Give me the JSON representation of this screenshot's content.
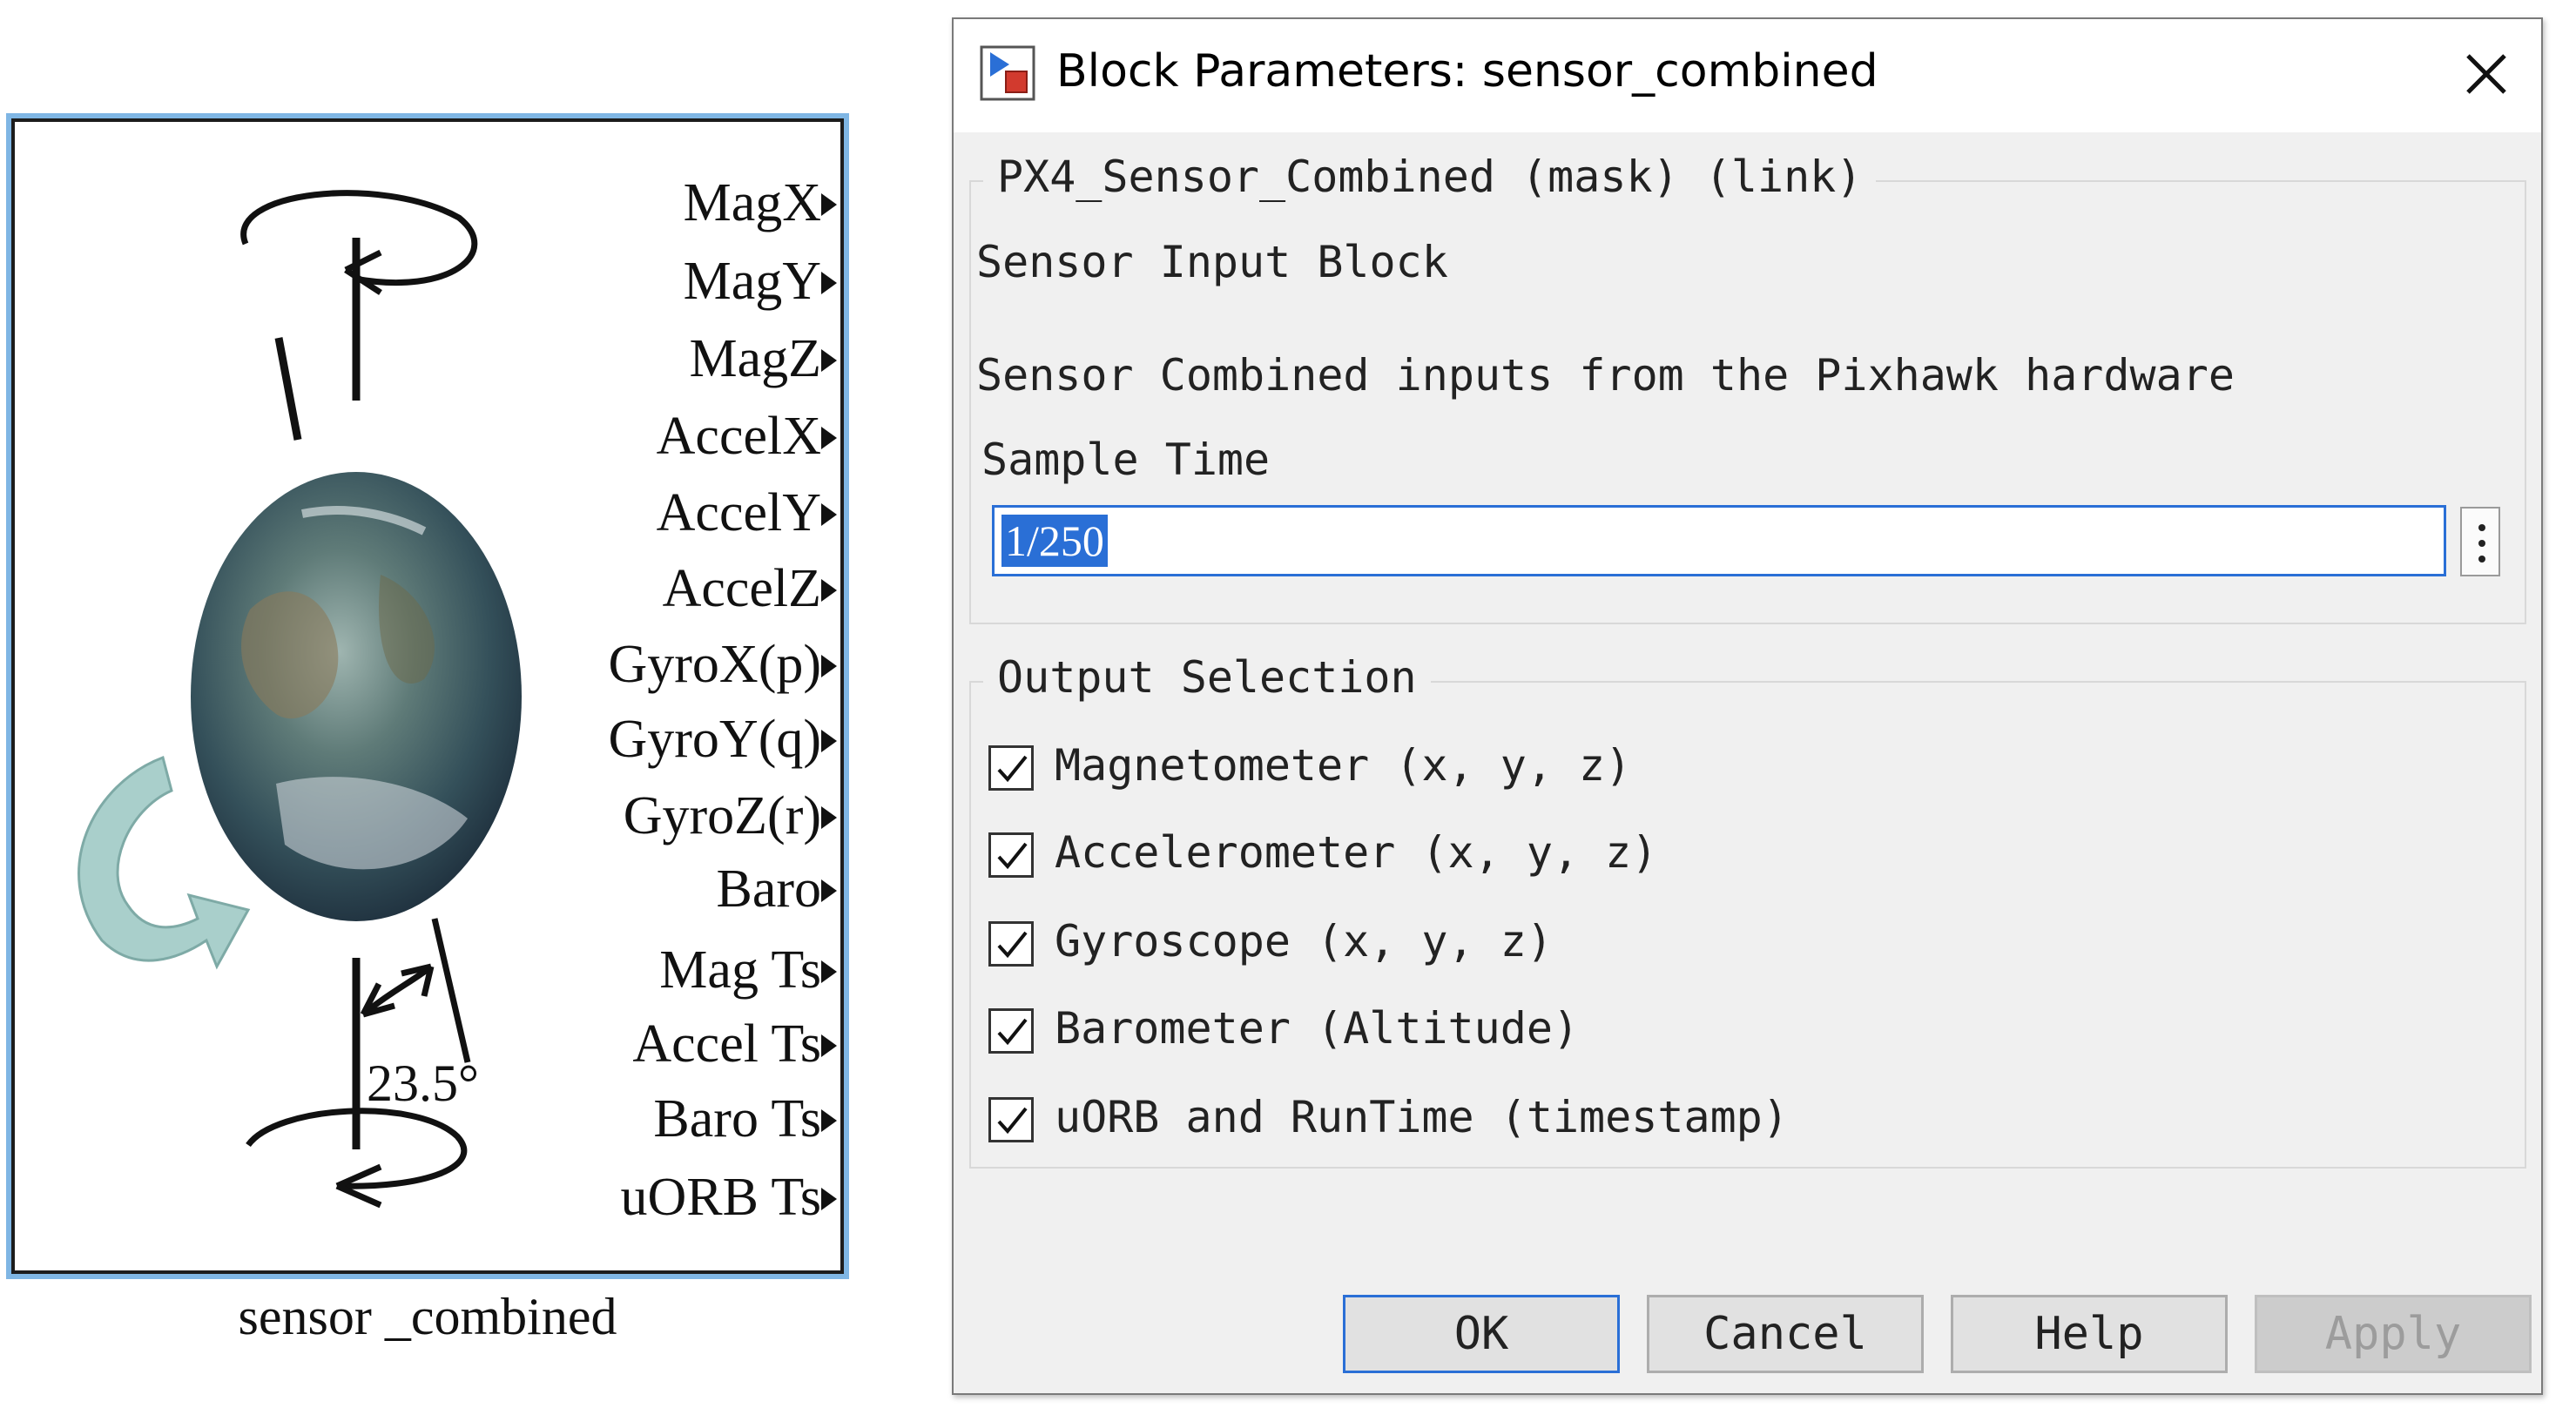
{
  "block": {
    "name": "sensor _combined",
    "angle_label": "23.5°",
    "ports": [
      "MagX",
      "MagY",
      "MagZ",
      "AccelX",
      "AccelY",
      "AccelZ",
      "GyroX(p)",
      "GyroY(q)",
      "GyroZ(r)",
      "Baro",
      "Mag Ts",
      "Accel Ts",
      "Baro Ts",
      "uORB Ts"
    ]
  },
  "dialog": {
    "title": "Block Parameters: sensor_combined",
    "mask_title": "PX4_Sensor_Combined (mask) (link)",
    "block_description": "Sensor Input Block",
    "description": "Sensor Combined inputs from the Pixhawk hardware",
    "sample_time_label": "Sample Time",
    "sample_time_value": "1/250",
    "output_group_title": "Output Selection",
    "outputs": [
      {
        "label": "Magnetometer (x, y, z)",
        "checked": true
      },
      {
        "label": "Accelerometer (x, y, z)",
        "checked": true
      },
      {
        "label": "Gyroscope (x, y, z)",
        "checked": true
      },
      {
        "label": "Barometer (Altitude)",
        "checked": true
      },
      {
        "label": "uORB and RunTime (timestamp)",
        "checked": true
      }
    ],
    "buttons": {
      "ok": "OK",
      "cancel": "Cancel",
      "help": "Help",
      "apply": "Apply"
    }
  },
  "colors": {
    "accent": "#2a6fd6",
    "block_highlight": "#7fb6e4",
    "dialog_bg": "#f0f0f0"
  }
}
